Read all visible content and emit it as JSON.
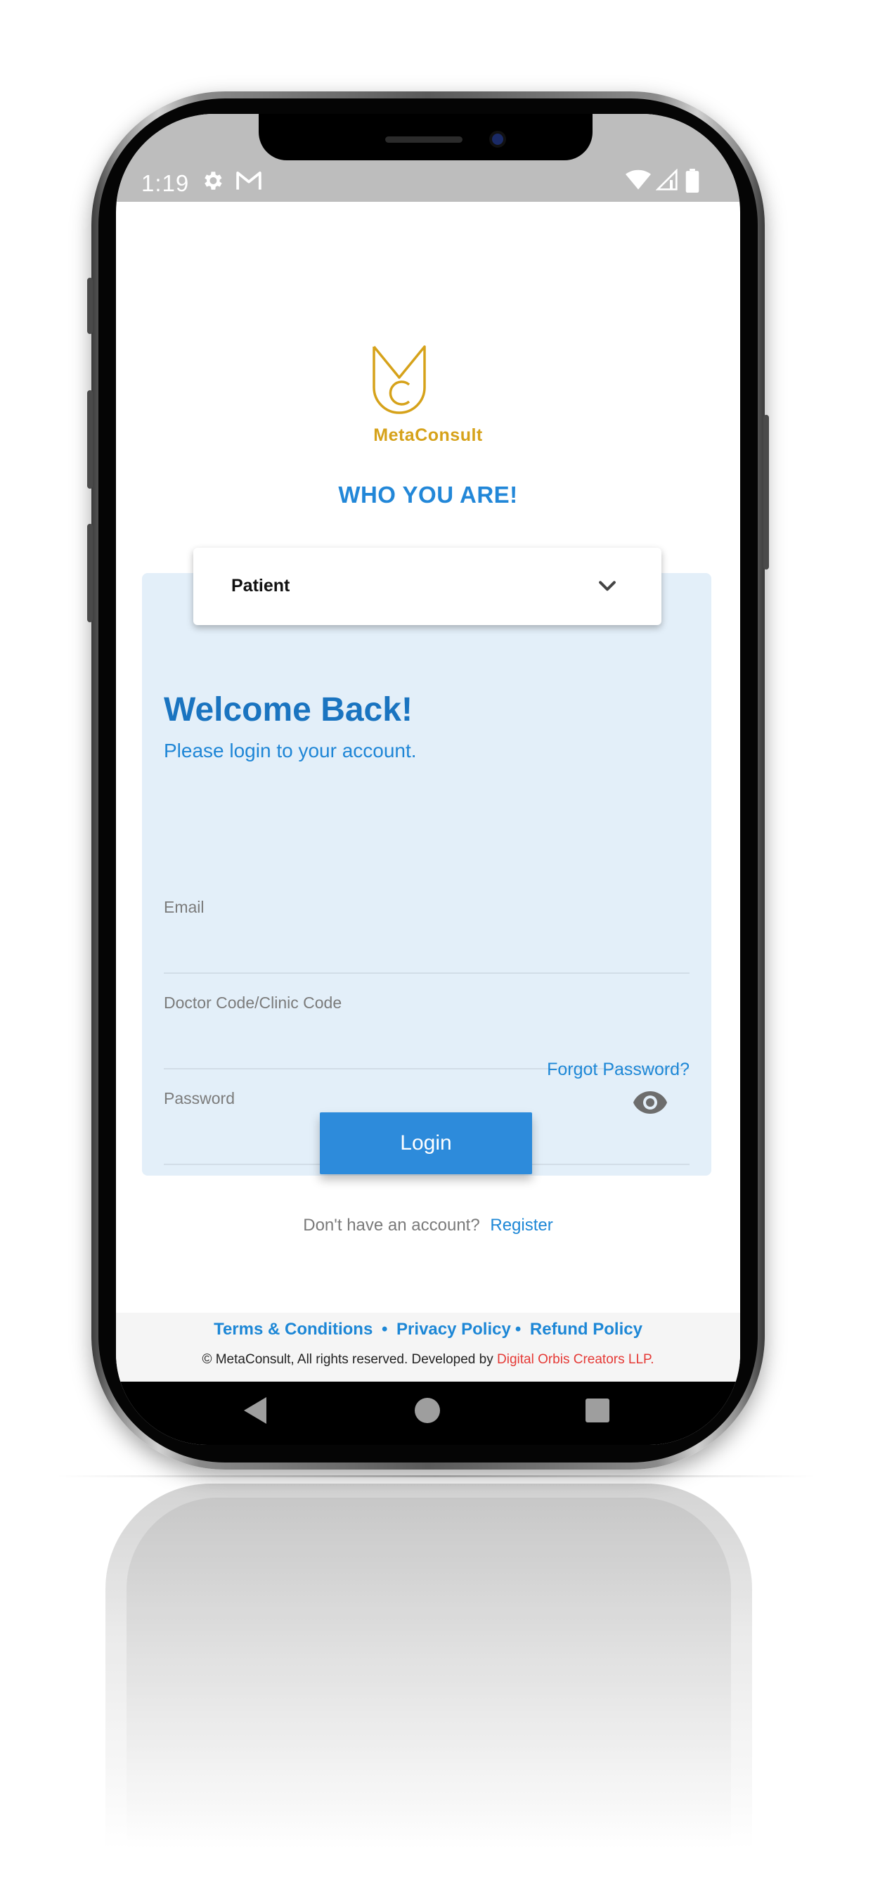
{
  "status_bar": {
    "time": "1:19"
  },
  "brand": {
    "name": "MetaConsult",
    "logo_color": "#d6a21a"
  },
  "role_section": {
    "title": "WHO YOU ARE!",
    "selected_role": "Patient"
  },
  "login": {
    "welcome": "Welcome Back!",
    "subtitle": "Please login to your account.",
    "email_placeholder": "Email",
    "code_placeholder": "Doctor Code/Clinic Code",
    "password_placeholder": "Password",
    "forgot_password": "Forgot Password?",
    "login_button": "Login",
    "no_account": "Don't have an account?",
    "register": "Register"
  },
  "footer": {
    "terms": "Terms & Conditions",
    "privacy": "Privacy Policy",
    "refund": "Refund Policy",
    "separator": "•",
    "copyright": "© MetaConsult, All rights reserved. Developed by",
    "developer": "Digital Orbis Creators LLP."
  },
  "colors": {
    "primary": "#2d8bdb",
    "card_background": "#e3eff9",
    "developer_link": "#e53935"
  }
}
